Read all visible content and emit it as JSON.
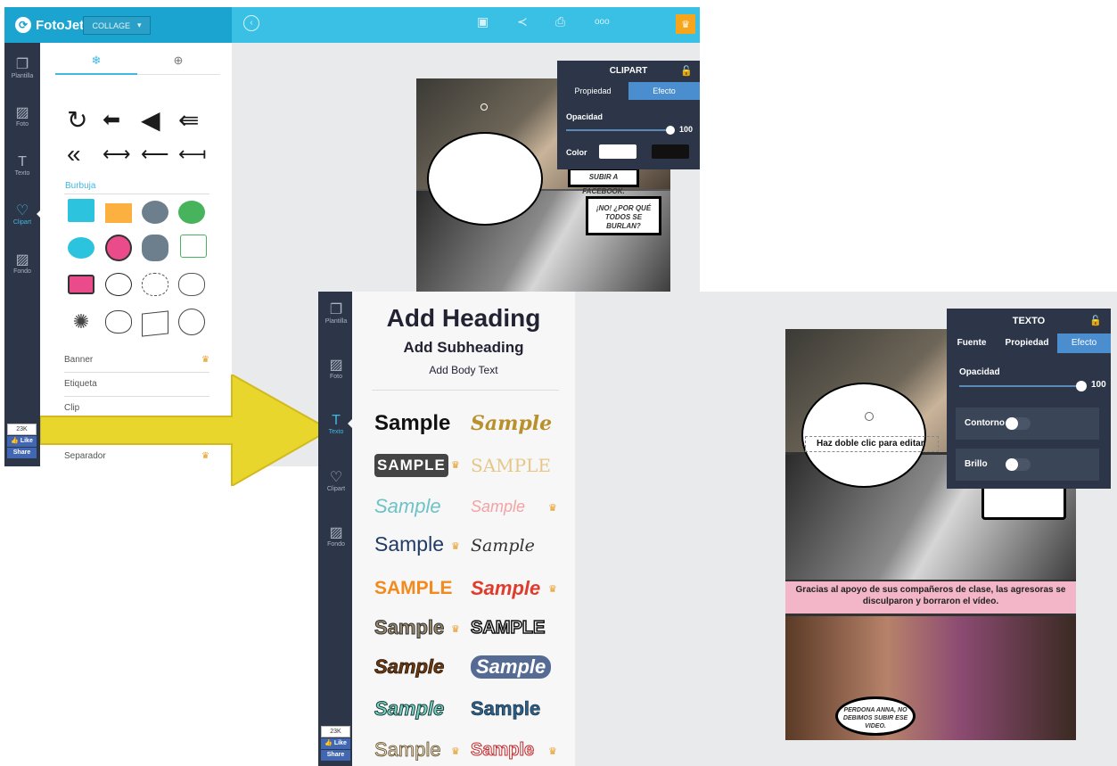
{
  "top_window": {
    "brand": "FotoJet",
    "mode_select": "COLLAGE",
    "sidebar": [
      {
        "label": "Plantilla",
        "icon": "template-icon"
      },
      {
        "label": "Foto",
        "icon": "photo-icon"
      },
      {
        "label": "Texto",
        "icon": "text-icon"
      },
      {
        "label": "Clipart",
        "icon": "heart-icon",
        "active": true
      },
      {
        "label": "Fondo",
        "icon": "background-icon"
      }
    ],
    "section_bubble": "Burbuja",
    "list_items": [
      "Banner",
      "Etiqueta",
      "Clip",
      "Separador"
    ],
    "like_count": "23K",
    "like_label": "Like",
    "share_label": "Share",
    "comic_text_1": "¡NO! ¿POR QUÉ TODOS SE BURLAN?",
    "comic_text_2": "SUBIR A FACEBOOK.",
    "clipart_panel": {
      "title": "CLIPART",
      "tab_1": "Propiedad",
      "tab_2": "Efecto",
      "opacity_label": "Opacidad",
      "opacity_value": "100",
      "color_label": "Color"
    }
  },
  "bottom_window": {
    "sidebar": [
      {
        "label": "Plantilla",
        "icon": "template-icon"
      },
      {
        "label": "Foto",
        "icon": "photo-icon"
      },
      {
        "label": "Texto",
        "icon": "text-icon",
        "active": true
      },
      {
        "label": "Clipart",
        "icon": "heart-icon"
      },
      {
        "label": "Fondo",
        "icon": "background-icon"
      }
    ],
    "heading": "Add Heading",
    "subheading": "Add Subheading",
    "body_text": "Add Body Text",
    "samples": [
      "Sample",
      "Sample",
      "SAMPLE",
      "SAMPLE",
      "Sample",
      "Sample",
      "Sample",
      "Sample",
      "SAMPLE",
      "Sample",
      "Sample",
      "SAMPLE",
      "Sample",
      "Sample",
      "Sample",
      "Sample",
      "Sample",
      "Sample"
    ],
    "like_count": "23K",
    "like_label": "Like",
    "share_label": "Share",
    "edit_hint": "Haz doble clic para editar",
    "caption": "Gracias al apoyo de sus compañeros de clase, las agresoras se disculparon y borraron el vídeo.",
    "comic_text_3": "PERDONA ANNA, NO DEBIMOS SUBIR ESE VIDEO.",
    "texto_panel": {
      "title": "TEXTO",
      "tab_1": "Fuente",
      "tab_2": "Propiedad",
      "tab_3": "Efecto",
      "opacity_label": "Opacidad",
      "opacity_value": "100",
      "outline_label": "Contorno",
      "brightness_label": "Brillo"
    }
  },
  "colors": {
    "accent": "#40b8e0",
    "dark_panel": "#2c3648",
    "toolbar": "#39c0e4",
    "crown": "#f7a51a",
    "caption_bg": "#f2b6c8"
  }
}
